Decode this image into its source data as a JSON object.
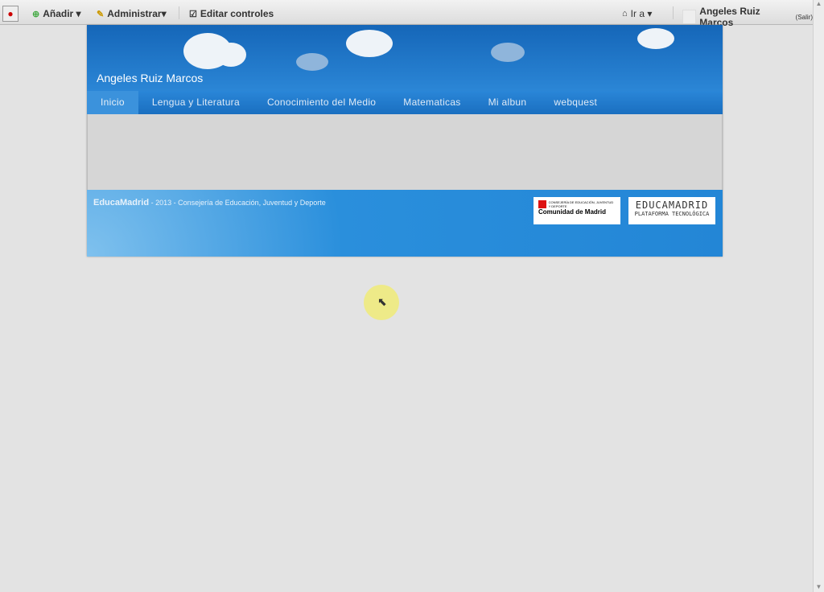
{
  "toolbar": {
    "add": "Añadir ▾",
    "manage": "Administrar▾",
    "edit_controls": "Editar controles",
    "goto": "Ir a ▾",
    "user": "Angeles Ruiz Marcos",
    "logout": "(Salir)"
  },
  "site": {
    "title": "Angeles Ruiz Marcos",
    "nav": [
      "Inicio",
      "Lengua y Literatura",
      "Conocimiento del Medio",
      "Matematicas",
      "Mi albun",
      "webquest"
    ],
    "footer": {
      "brand": "EducaMadrid",
      "text": " - 2013 - Consejería de Educación, Juventud y Deporte",
      "logo1_small": "CONSEJERÍA DE EDUCACIÓN, JUVENTUD Y DEPORTE",
      "logo1": "Comunidad de Madrid",
      "logo2": "EDUCAMADRID",
      "logo2_sub": "PLATAFORMA TECNOLÓGICA"
    }
  }
}
